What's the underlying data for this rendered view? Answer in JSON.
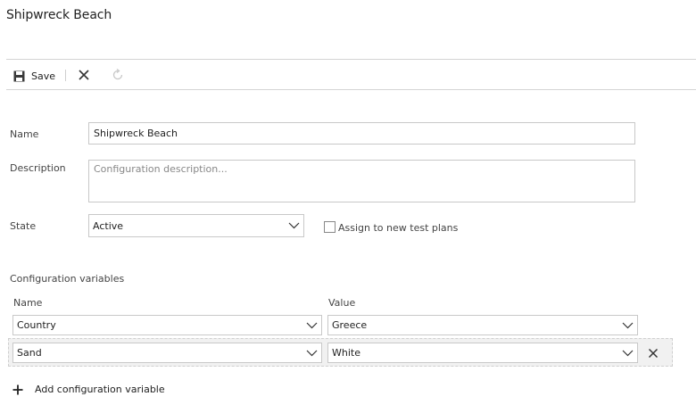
{
  "page": {
    "title": "Shipwreck Beach"
  },
  "toolbar": {
    "save_label": "Save"
  },
  "form": {
    "name_label": "Name",
    "name_value": "Shipwreck Beach",
    "description_label": "Description",
    "description_placeholder": "Configuration description...",
    "state_label": "State",
    "state_value": "Active",
    "assign_label": "Assign to new test plans",
    "assign_checked": false
  },
  "variables": {
    "section_label": "Configuration variables",
    "name_header": "Name",
    "value_header": "Value",
    "rows": [
      {
        "name": "Country",
        "value": "Greece"
      },
      {
        "name": "Sand",
        "value": "White"
      }
    ],
    "add_label": "Add configuration variable"
  }
}
